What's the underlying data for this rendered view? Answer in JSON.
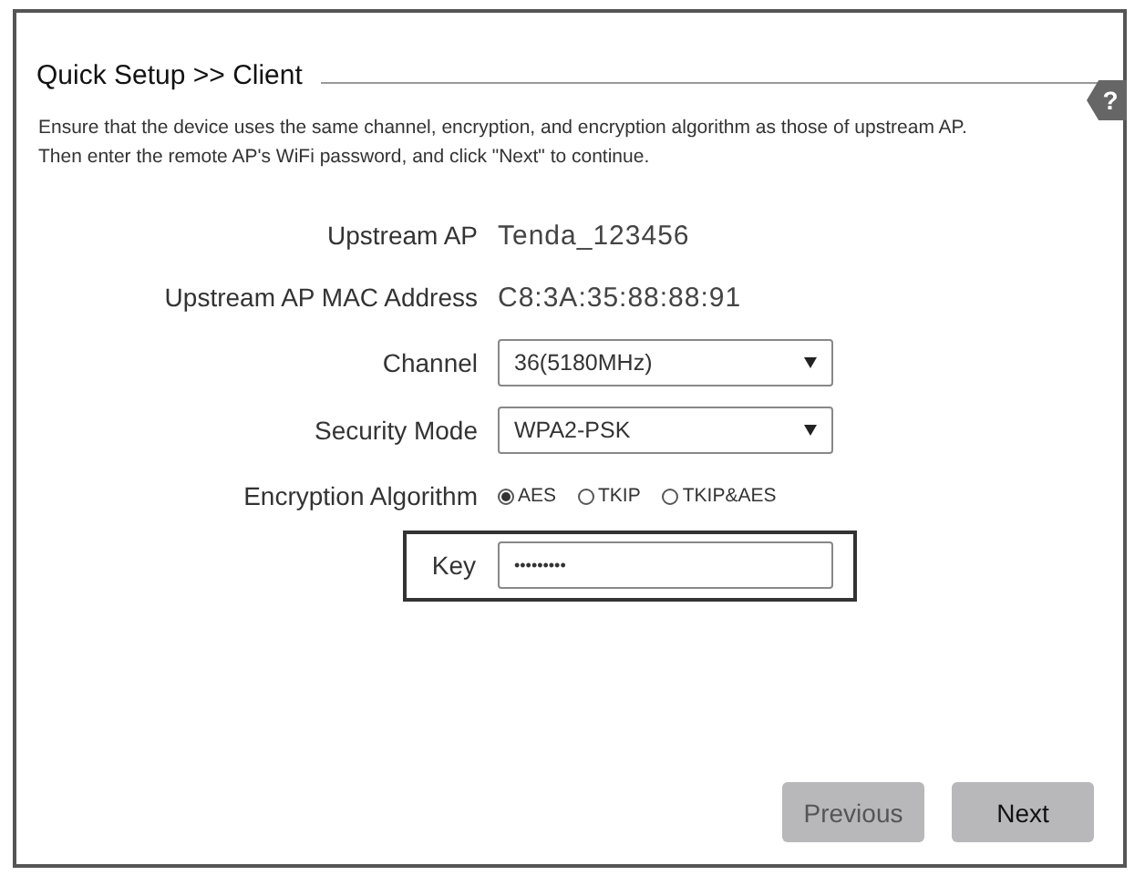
{
  "header": {
    "title": "Quick Setup >>  Client",
    "help": "?"
  },
  "instructions": [
    "Ensure that the device uses the same channel, encryption, and encryption algorithm as those of upstream AP.",
    "Then enter the remote AP's WiFi password, and click \"Next\" to continue."
  ],
  "fields": [
    {
      "kind": "text",
      "label": "Upstream AP",
      "value": "Tenda_123456"
    },
    {
      "kind": "text",
      "label": "Upstream AP MAC Address",
      "value": "C8:3A:35:88:88:91"
    },
    {
      "kind": "select",
      "label": "Channel",
      "value": "36(5180MHz)"
    },
    {
      "kind": "select",
      "label": "Security Mode",
      "value": "WPA2-PSK"
    },
    {
      "kind": "radio",
      "label": "Encryption Algorithm",
      "options": [
        {
          "label": "AES",
          "selected": true
        },
        {
          "label": "TKIP",
          "selected": false
        },
        {
          "label": "TKIP&AES",
          "selected": false
        }
      ]
    },
    {
      "kind": "password",
      "label": "Key",
      "value": "•••••••••",
      "highlighted": true
    }
  ],
  "buttons": [
    {
      "label": "Previous",
      "disabled": true
    },
    {
      "label": "Next",
      "disabled": false
    }
  ]
}
